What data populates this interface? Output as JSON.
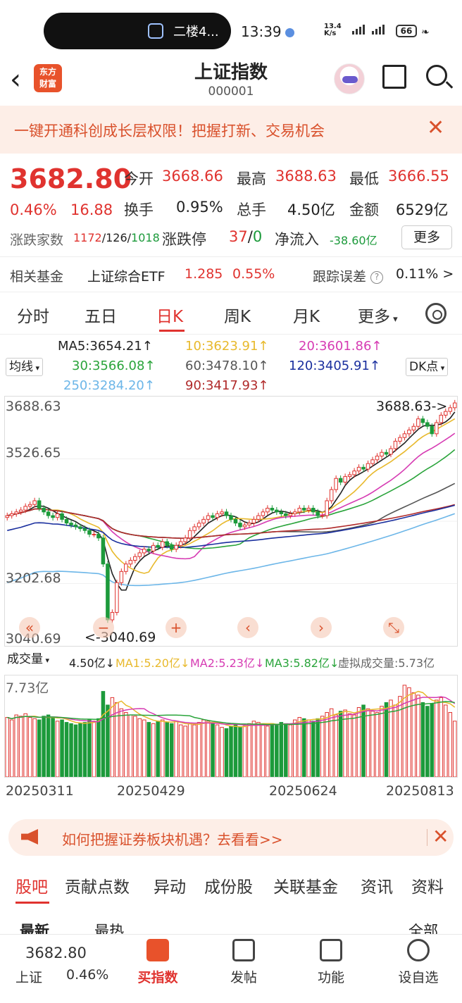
{
  "status_bar": {
    "notification": "二楼4...",
    "time": "13:39",
    "net_speed_top": "13.4",
    "net_speed_bottom": "K/s",
    "battery": "66"
  },
  "nav": {
    "title": "上证指数",
    "code": "000001",
    "logo_text_1": "东方",
    "logo_text_2": "财富"
  },
  "banner": {
    "text": "一键开通科创成长层权限！把握打新、交易机会",
    "close": "✕"
  },
  "quote": {
    "price": "3682.80",
    "pct": "0.46%",
    "change": "16.88",
    "open_label": "今开",
    "open": "3668.66",
    "high_label": "最高",
    "high": "3688.63",
    "low_label": "最低",
    "low": "3666.55",
    "turnover_label": "换手",
    "turnover": "0.95%",
    "hands_label": "总手",
    "hands": "4.50亿",
    "amount_label": "金额",
    "amount": "6529亿",
    "breadth_label": "涨跌家数",
    "breadth_up": "1172",
    "breadth_flat": "126",
    "breadth_down": "1018",
    "limit_label": "涨跌停",
    "limit_up": "37",
    "limit_down": "0",
    "netflow_label": "净流入",
    "netflow": "-38.60亿",
    "more": "更多"
  },
  "fund": {
    "label": "相关基金",
    "name": "上证综合ETF",
    "price": "1.285",
    "pct": "0.55%",
    "track_label": "跟踪误差",
    "track_value": "0.11%",
    "arrow": ">"
  },
  "tabs": [
    "分时",
    "五日",
    "日K",
    "周K",
    "月K",
    "更多"
  ],
  "ma_legend": {
    "selector": "均线",
    "ma5": "MA5:3654.21↑",
    "ma10": "10:3623.91↑",
    "ma20": "20:3601.86↑",
    "ma30": "30:3566.08↑",
    "ma60": "60:3478.10↑",
    "ma120": "120:3405.91↑",
    "ma250": "250:3284.20↑",
    "ma90": "90:3417.93↑",
    "dk": "DK点"
  },
  "colors": {
    "up": "#e0332f",
    "down": "#1c9a3b",
    "ma5": "#222222",
    "ma10": "#e8b92c",
    "ma20": "#d63bb3",
    "ma30": "#2aa43b",
    "ma60": "#555555",
    "ma120": "#1a2f9e",
    "ma250": "#6cb6e8",
    "ma90": "#b02a2a"
  },
  "chart_data": {
    "type": "candlestick",
    "y_ticks": [
      "3688.63",
      "3526.65",
      "3202.68",
      "3040.69"
    ],
    "high_marker": "3688.63->",
    "low_marker": "<-3040.69",
    "x_dates": [
      "20250311",
      "20250429",
      "20250624",
      "20250813"
    ],
    "close": [
      3380,
      3385,
      3390,
      3395,
      3405,
      3410,
      3420,
      3400,
      3390,
      3380,
      3375,
      3385,
      3370,
      3360,
      3355,
      3350,
      3345,
      3340,
      3330,
      3330,
      3320,
      3250,
      3100,
      3120,
      3200,
      3230,
      3250,
      3260,
      3270,
      3280,
      3290,
      3285,
      3300,
      3295,
      3310,
      3300,
      3290,
      3300,
      3310,
      3320,
      3340,
      3350,
      3360,
      3370,
      3380,
      3375,
      3385,
      3390,
      3380,
      3370,
      3360,
      3350,
      3355,
      3360,
      3370,
      3380,
      3390,
      3400,
      3395,
      3390,
      3385,
      3380,
      3385,
      3390,
      3400,
      3395,
      3400,
      3390,
      3380,
      3380,
      3420,
      3450,
      3480,
      3470,
      3485,
      3490,
      3500,
      3510,
      3505,
      3520,
      3530,
      3540,
      3550,
      3545,
      3560,
      3580,
      3590,
      3600,
      3610,
      3620,
      3640,
      3630,
      3620,
      3600,
      3630,
      3650,
      3660,
      3670,
      3682.8
    ]
  },
  "volume": {
    "selector": "成交量",
    "current": "4.50亿↓",
    "ma1": "MA1:5.20亿↓",
    "ma2": "MA2:5.23亿↓",
    "ma3": "MA3:5.82亿↓",
    "virtual": "虚拟成交量:5.73亿",
    "y_max": "7.73亿",
    "values": [
      4.8,
      4.6,
      5.0,
      4.9,
      5.1,
      4.8,
      4.7,
      4.6,
      4.9,
      5.0,
      4.8,
      4.5,
      4.6,
      4.4,
      4.3,
      4.2,
      4.3,
      4.4,
      4.6,
      4.5,
      4.7,
      6.9,
      5.8,
      6.4,
      6.0,
      5.5,
      5.2,
      5.0,
      4.9,
      4.7,
      4.6,
      4.4,
      4.3,
      4.5,
      4.6,
      4.4,
      4.3,
      4.5,
      4.2,
      4.1,
      4.3,
      4.2,
      4.4,
      4.6,
      4.5,
      4.3,
      4.2,
      4.0,
      3.9,
      4.1,
      4.2,
      4.0,
      4.1,
      4.3,
      4.5,
      4.4,
      4.2,
      4.1,
      4.3,
      4.2,
      4.4,
      4.3,
      4.2,
      4.6,
      4.8,
      4.7,
      4.6,
      4.5,
      4.7,
      4.9,
      5.2,
      5.5,
      5.0,
      5.3,
      5.4,
      5.1,
      5.0,
      5.6,
      5.8,
      5.5,
      5.3,
      5.2,
      5.7,
      6.0,
      6.2,
      5.8,
      6.5,
      7.4,
      7.2,
      6.8,
      6.6,
      6.0,
      5.7,
      5.9,
      6.2,
      6.4,
      5.8,
      5.2,
      4.5
    ]
  },
  "chart_controls": [
    "«",
    "−",
    "+",
    "‹",
    "›",
    "⤡"
  ],
  "ad": {
    "text": "如何把握证券板块机遇？去看看>>",
    "close": "✕"
  },
  "bottom_tabs": [
    "股吧",
    "贡献点数",
    "异动",
    "成份股",
    "关联基金",
    "资讯",
    "资料"
  ],
  "sub_tabs": {
    "latest": "最新",
    "hot": "最热",
    "all": "全部"
  },
  "footer": {
    "price": "3682.80",
    "name": "上证",
    "pct": "0.46%",
    "buy": "买指数",
    "post": "发帖",
    "func": "功能",
    "watch": "设自选"
  }
}
